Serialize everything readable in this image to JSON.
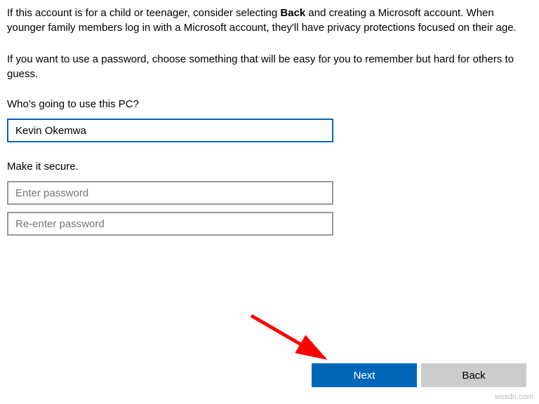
{
  "info": {
    "para1_a": "If this account is for a child or teenager, consider selecting ",
    "para1_bold": "Back",
    "para1_b": " and creating a Microsoft account. When younger family members log in with a Microsoft account, they'll have privacy protections focused on their age.",
    "para2": "If you want to use a password, choose something that will be easy for you to remember but hard for others to guess."
  },
  "form": {
    "user_label": "Who's going to use this PC?",
    "user_value": "Kevin Okemwa",
    "secure_label": "Make it secure.",
    "password_placeholder": "Enter password",
    "reenter_placeholder": "Re-enter password"
  },
  "buttons": {
    "next": "Next",
    "back": "Back"
  },
  "watermark": "wsxdn.com"
}
